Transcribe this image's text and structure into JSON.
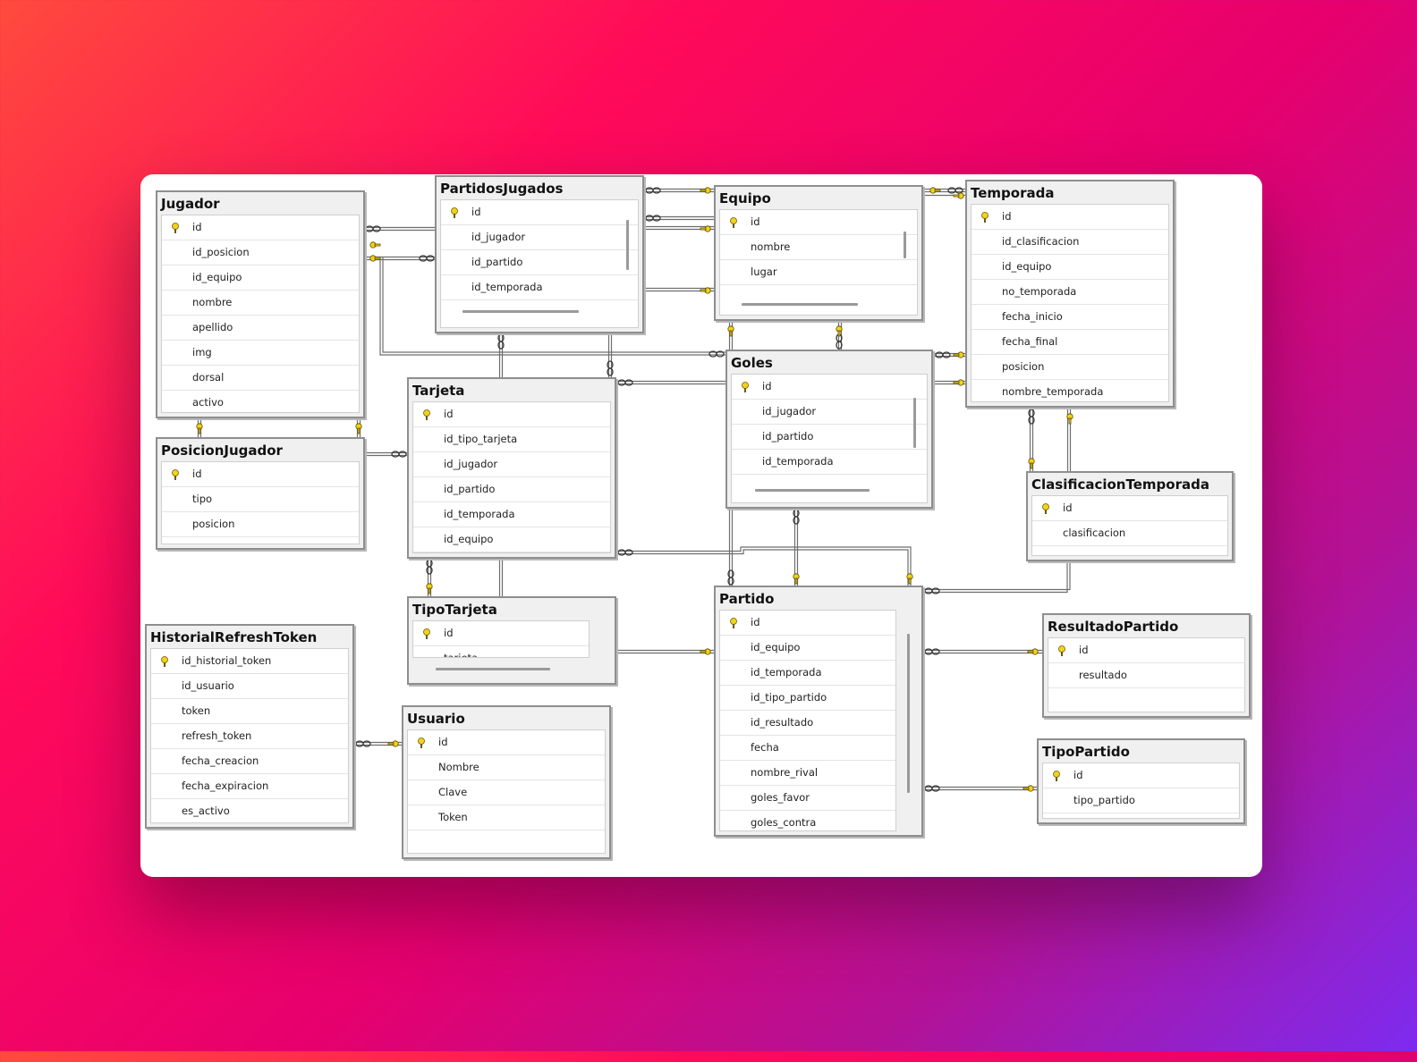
{
  "tables": {
    "jugador": {
      "name": "Jugador",
      "columns": [
        "id",
        "id_posicion",
        "id_equipo",
        "nombre",
        "apellido",
        "img",
        "dorsal",
        "activo"
      ]
    },
    "partidos_jugados": {
      "name": "PartidosJugados",
      "columns": [
        "id",
        "id_jugador",
        "id_partido",
        "id_temporada"
      ]
    },
    "equipo": {
      "name": "Equipo",
      "columns": [
        "id",
        "nombre",
        "lugar"
      ]
    },
    "temporada": {
      "name": "Temporada",
      "columns": [
        "id",
        "id_clasificacion",
        "id_equipo",
        "no_temporada",
        "fecha_inicio",
        "fecha_final",
        "posicion",
        "nombre_temporada"
      ]
    },
    "posicion_jugador": {
      "name": "PosicionJugador",
      "columns": [
        "id",
        "tipo",
        "posicion"
      ]
    },
    "tarjeta": {
      "name": "Tarjeta",
      "columns": [
        "id",
        "id_tipo_tarjeta",
        "id_jugador",
        "id_partido",
        "id_temporada",
        "id_equipo"
      ]
    },
    "goles": {
      "name": "Goles",
      "columns": [
        "id",
        "id_jugador",
        "id_partido",
        "id_temporada"
      ]
    },
    "clasificacion_temporada": {
      "name": "ClasificacionTemporada",
      "columns": [
        "id",
        "clasificacion"
      ]
    },
    "tipo_tarjeta": {
      "name": "TipoTarjeta",
      "columns": [
        "id",
        "tarjeta"
      ]
    },
    "partido": {
      "name": "Partido",
      "columns": [
        "id",
        "id_equipo",
        "id_temporada",
        "id_tipo_partido",
        "id_resultado",
        "fecha",
        "nombre_rival",
        "goles_favor",
        "goles_contra"
      ]
    },
    "historial_refresh_token": {
      "name": "HistorialRefreshToken",
      "columns": [
        "id_historial_token",
        "id_usuario",
        "token",
        "refresh_token",
        "fecha_creacion",
        "fecha_expiracion",
        "es_activo"
      ]
    },
    "usuario": {
      "name": "Usuario",
      "columns": [
        "id",
        "Nombre",
        "Clave",
        "Token"
      ]
    },
    "resultado_partido": {
      "name": "ResultadoPartido",
      "columns": [
        "id",
        "resultado"
      ]
    },
    "tipo_partido": {
      "name": "TipoPartido",
      "columns": [
        "id",
        "tipo_partido"
      ]
    }
  },
  "colors": {
    "key": "#f2d21a",
    "relationship_line": "#6e6e6e",
    "header": "#f0f0f0",
    "border": "#8e8e8e"
  },
  "icons": {
    "primary_key": "key-icon",
    "many_end": "infinity-icon",
    "one_end": "key-icon"
  }
}
